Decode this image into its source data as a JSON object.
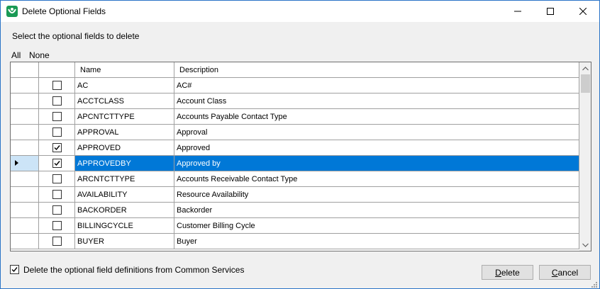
{
  "window": {
    "title": "Delete Optional Fields",
    "accent": "#2b74c7"
  },
  "instruction": "Select the optional fields to delete",
  "select_links": {
    "all": "All",
    "none": "None"
  },
  "grid": {
    "columns": [
      "Name",
      "Description"
    ],
    "selected_color": "#0078d7",
    "rows": [
      {
        "name": "AC",
        "description": "AC#",
        "checked": false,
        "selected": false
      },
      {
        "name": "ACCTCLASS",
        "description": "Account Class",
        "checked": false,
        "selected": false
      },
      {
        "name": "APCNTCTTYPE",
        "description": "Accounts Payable Contact Type",
        "checked": false,
        "selected": false
      },
      {
        "name": "APPROVAL",
        "description": "Approval",
        "checked": false,
        "selected": false
      },
      {
        "name": "APPROVED",
        "description": "Approved",
        "checked": true,
        "selected": false
      },
      {
        "name": "APPROVEDBY",
        "description": "Approved by",
        "checked": true,
        "selected": true
      },
      {
        "name": "ARCNTCTTYPE",
        "description": "Accounts Receivable Contact Type",
        "checked": false,
        "selected": false
      },
      {
        "name": "AVAILABILITY",
        "description": "Resource Availability",
        "checked": false,
        "selected": false
      },
      {
        "name": "BACKORDER",
        "description": "Backorder",
        "checked": false,
        "selected": false
      },
      {
        "name": "BILLINGCYCLE",
        "description": "Customer Billing Cycle",
        "checked": false,
        "selected": false
      },
      {
        "name": "BUYER",
        "description": "Buyer",
        "checked": false,
        "selected": false
      }
    ]
  },
  "footer": {
    "delete_definitions_label": "Delete the optional field definitions from Common Services",
    "delete_definitions_checked": true,
    "delete_button": {
      "first": "D",
      "rest": "elete"
    },
    "cancel_button": {
      "first": "C",
      "rest": "ancel"
    }
  }
}
